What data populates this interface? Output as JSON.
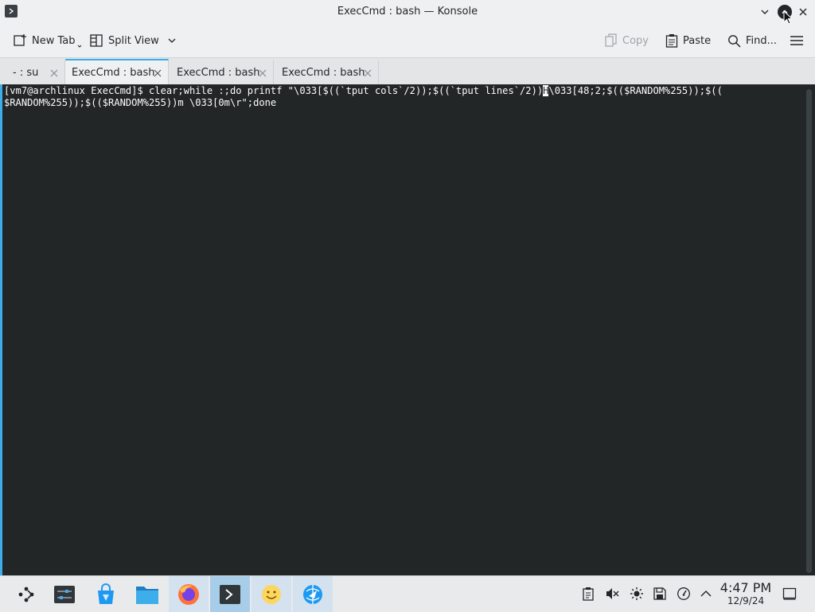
{
  "window": {
    "title": "ExecCmd : bash — Konsole"
  },
  "toolbar": {
    "new_tab": "New Tab",
    "split_view": "Split View",
    "copy": "Copy",
    "paste": "Paste",
    "find": "Find..."
  },
  "tabs": [
    {
      "label": "- : su",
      "active": false
    },
    {
      "label": "ExecCmd : bash",
      "active": true
    },
    {
      "label": "ExecCmd : bash",
      "active": false
    },
    {
      "label": "ExecCmd : bash",
      "active": false
    }
  ],
  "terminal": {
    "line1_before_cursor": "[vm7@archlinux ExecCmd]$ clear;while :;do printf \"\\033[$((`tput cols`/2));$((`tput lines`/2))",
    "cursor_char": "H",
    "line1_after_cursor": "\\033[48;2;$(($RANDOM%255));$((",
    "line2": "$RANDOM%255));$(($RANDOM%255))m \\033[0m\\r\";done"
  },
  "taskbar": {
    "apps": [
      {
        "name": "application-launcher-icon"
      },
      {
        "name": "system-settings-icon"
      },
      {
        "name": "discover-store-icon"
      },
      {
        "name": "file-manager-icon"
      },
      {
        "name": "firefox-icon"
      },
      {
        "name": "konsole-icon",
        "active": true
      },
      {
        "name": "smiley-app-icon"
      },
      {
        "name": "browser-globe-icon"
      }
    ],
    "clock_time": "4:47 PM",
    "clock_date": "12/9/24"
  },
  "colors": {
    "accent": "#3daee9",
    "terminal_bg": "#232627",
    "terminal_fg": "#fcfcfc"
  }
}
